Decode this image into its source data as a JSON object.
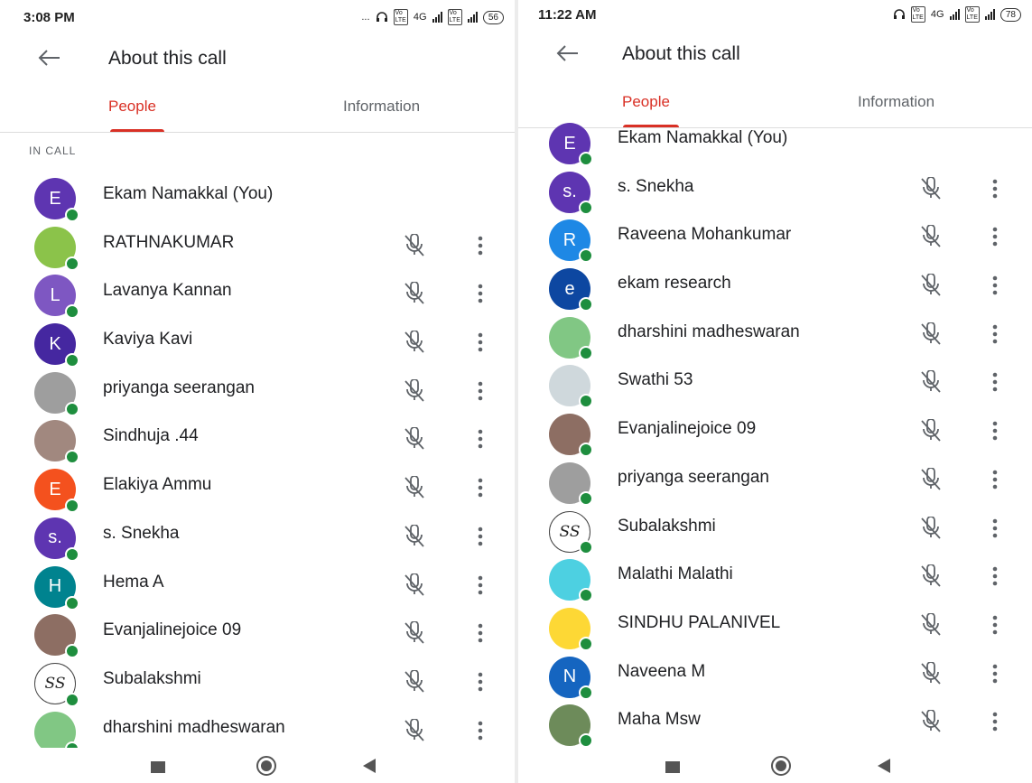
{
  "left": {
    "status": {
      "time": "3:08 PM",
      "extra": "...",
      "net": "4G",
      "battery": "56"
    },
    "title": "About this call",
    "tabs": [
      "People",
      "Information"
    ],
    "section": "IN CALL",
    "participants": [
      {
        "name": "Ekam Namakkal (You)",
        "initial": "E",
        "color": "#5e35b1",
        "controls": false
      },
      {
        "name": "RATHNAKUMAR",
        "initial": "",
        "color": "#8bc34a",
        "controls": true
      },
      {
        "name": "Lavanya Kannan",
        "initial": "L",
        "color": "#7e57c2",
        "controls": true
      },
      {
        "name": "Kaviya Kavi",
        "initial": "K",
        "color": "#4527a0",
        "controls": true
      },
      {
        "name": "priyanga seerangan",
        "initial": "",
        "color": "#9e9e9e",
        "controls": true
      },
      {
        "name": "Sindhuja .44",
        "initial": "",
        "color": "#a1887f",
        "controls": true
      },
      {
        "name": "Elakiya Ammu",
        "initial": "E",
        "color": "#f4511e",
        "controls": true
      },
      {
        "name": "s. Snekha",
        "initial": "s.",
        "color": "#5e35b1",
        "controls": true
      },
      {
        "name": "Hema A",
        "initial": "H",
        "color": "#00838f",
        "controls": true
      },
      {
        "name": "Evanjalinejoice 09",
        "initial": "",
        "color": "#8d6e63",
        "controls": true
      },
      {
        "name": "Subalakshmi",
        "initial": "SS",
        "color": "#ffffff",
        "controls": true
      },
      {
        "name": "dharshini madheswaran",
        "initial": "",
        "color": "#81c784",
        "controls": true
      }
    ]
  },
  "right": {
    "status": {
      "time": "11:22 AM",
      "net": "4G",
      "battery": "78"
    },
    "title": "About this call",
    "tabs": [
      "People",
      "Information"
    ],
    "participants": [
      {
        "name": "Ekam Namakkal (You)",
        "initial": "E",
        "color": "#5e35b1",
        "controls": false
      },
      {
        "name": "s. Snekha",
        "initial": "s.",
        "color": "#5e35b1",
        "controls": true
      },
      {
        "name": "Raveena Mohankumar",
        "initial": "R",
        "color": "#1e88e5",
        "controls": true
      },
      {
        "name": "ekam research",
        "initial": "e",
        "color": "#0d47a1",
        "controls": true
      },
      {
        "name": "dharshini madheswaran",
        "initial": "",
        "color": "#81c784",
        "controls": true
      },
      {
        "name": "Swathi 53",
        "initial": "",
        "color": "#cfd8dc",
        "controls": true
      },
      {
        "name": "Evanjalinejoice 09",
        "initial": "",
        "color": "#8d6e63",
        "controls": true
      },
      {
        "name": "priyanga seerangan",
        "initial": "",
        "color": "#9e9e9e",
        "controls": true
      },
      {
        "name": "Subalakshmi",
        "initial": "SS",
        "color": "#ffffff",
        "controls": true
      },
      {
        "name": "Malathi Malathi",
        "initial": "",
        "color": "#4dd0e1",
        "controls": true
      },
      {
        "name": "SINDHU PALANIVEL",
        "initial": "",
        "color": "#fdd835",
        "controls": true
      },
      {
        "name": "Naveena M",
        "initial": "N",
        "color": "#1565c0",
        "controls": true
      },
      {
        "name": "Maha Msw",
        "initial": "",
        "color": "#6d8b5a",
        "controls": true
      }
    ]
  },
  "colors": {
    "accent": "#d93025",
    "online": "#1e8e3e",
    "text": "#202124"
  }
}
